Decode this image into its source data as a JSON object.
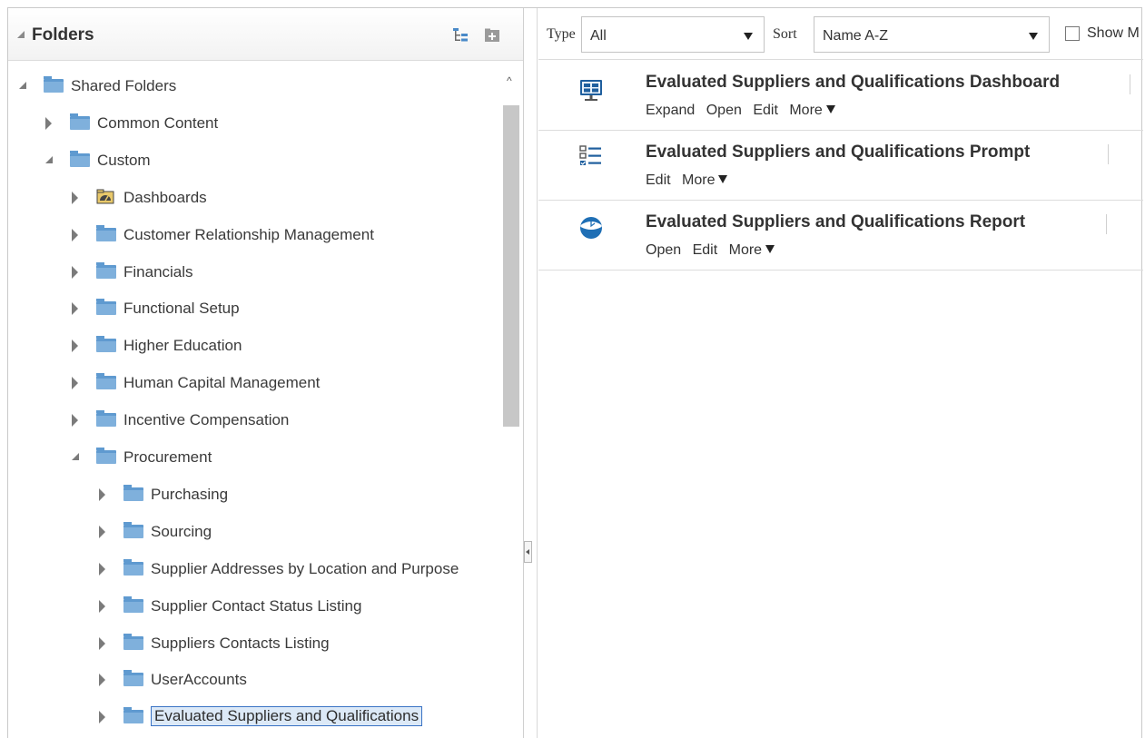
{
  "folders_panel": {
    "title": "Folders",
    "icons": [
      "folder-tree-icon",
      "new-folder-icon"
    ]
  },
  "tree": [
    {
      "label": "Shared Folders",
      "level": 0,
      "state": "open",
      "icon": "folder-icon"
    },
    {
      "label": "Common Content",
      "level": 1,
      "state": "closed",
      "icon": "folder-icon"
    },
    {
      "label": "Custom",
      "level": 1,
      "state": "open",
      "icon": "folder-icon"
    },
    {
      "label": "Dashboards",
      "level": 2,
      "state": "closed",
      "icon": "dashboard-folder-icon"
    },
    {
      "label": "Customer Relationship Management",
      "level": 2,
      "state": "closed",
      "icon": "folder-icon"
    },
    {
      "label": "Financials",
      "level": 2,
      "state": "closed",
      "icon": "folder-icon"
    },
    {
      "label": "Functional Setup",
      "level": 2,
      "state": "closed",
      "icon": "folder-icon"
    },
    {
      "label": "Higher Education",
      "level": 2,
      "state": "closed",
      "icon": "folder-icon"
    },
    {
      "label": "Human Capital Management",
      "level": 2,
      "state": "closed",
      "icon": "folder-icon"
    },
    {
      "label": "Incentive Compensation",
      "level": 2,
      "state": "closed",
      "icon": "folder-icon"
    },
    {
      "label": "Procurement",
      "level": 2,
      "state": "open",
      "icon": "folder-icon"
    },
    {
      "label": "Purchasing",
      "level": 3,
      "state": "closed",
      "icon": "folder-icon"
    },
    {
      "label": "Sourcing",
      "level": 3,
      "state": "closed",
      "icon": "folder-icon"
    },
    {
      "label": "Supplier Addresses by Location and Purpose",
      "level": 3,
      "state": "closed",
      "icon": "folder-icon"
    },
    {
      "label": "Supplier Contact Status Listing",
      "level": 3,
      "state": "closed",
      "icon": "folder-icon"
    },
    {
      "label": "Suppliers Contacts Listing",
      "level": 3,
      "state": "closed",
      "icon": "folder-icon"
    },
    {
      "label": "UserAccounts",
      "level": 3,
      "state": "closed",
      "icon": "folder-icon"
    },
    {
      "label": "Evaluated Suppliers and Qualifications",
      "level": 3,
      "state": "closed",
      "icon": "folder-icon",
      "selected": true
    }
  ],
  "toolbar": {
    "type_label": "Type",
    "type_value": "All",
    "sort_label": "Sort",
    "sort_value": "Name A-Z",
    "show_label": "Show M"
  },
  "items": [
    {
      "name": "Evaluated Suppliers and Qualifications Dashboard",
      "icon": "dashboard-icon",
      "actions": [
        "Expand",
        "Open",
        "Edit",
        "More"
      ]
    },
    {
      "name": "Evaluated Suppliers and Qualifications Prompt",
      "icon": "prompt-icon",
      "actions": [
        "Edit",
        "More"
      ]
    },
    {
      "name": "Evaluated Suppliers and Qualifications Report",
      "icon": "report-icon",
      "actions": [
        "Open",
        "Edit",
        "More"
      ]
    }
  ],
  "colors": {
    "folder": "#7fb0dc",
    "selection_bg": "#dce9f7",
    "selection_border": "#3a73c4",
    "icon_blue": "#1f6fb5"
  }
}
